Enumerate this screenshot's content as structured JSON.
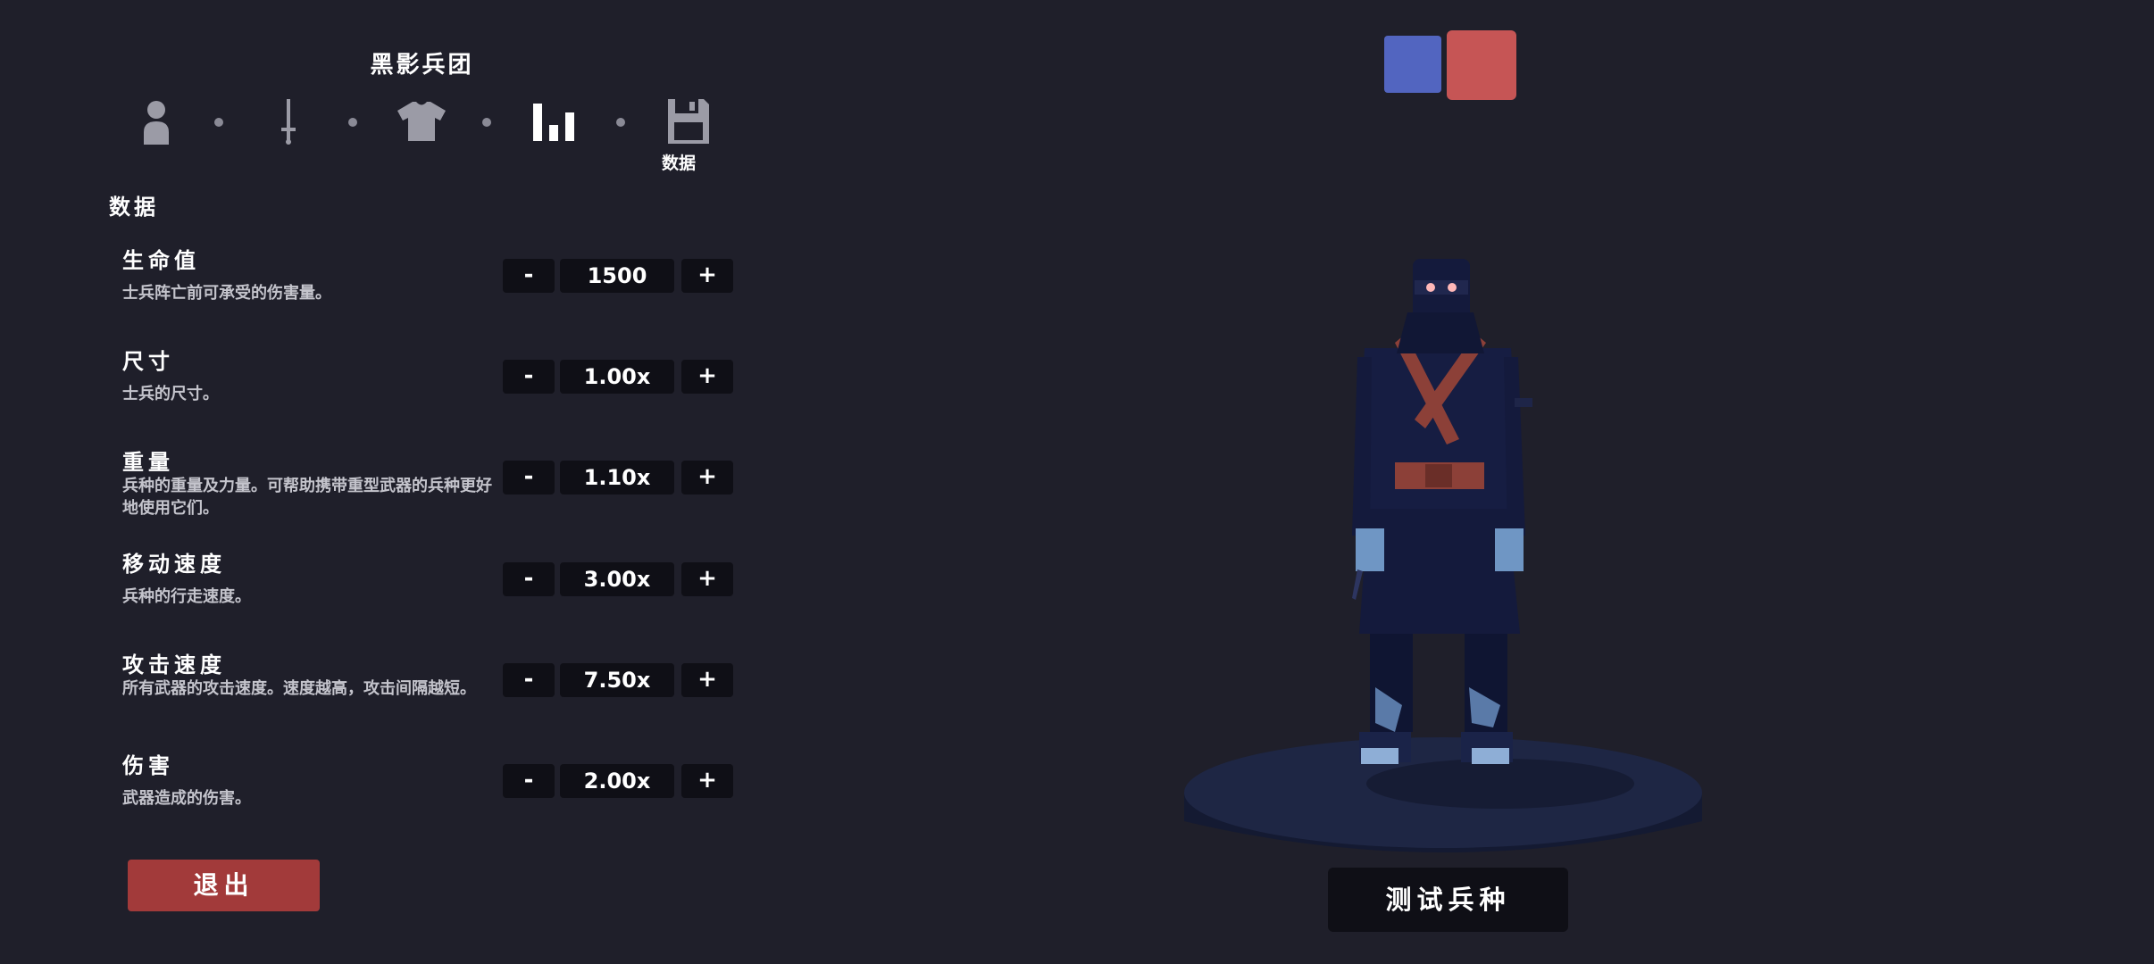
{
  "header": {
    "unit_name": "黑影兵团",
    "steps": [
      {
        "icon": "person-icon"
      },
      {
        "icon": "sword-icon"
      },
      {
        "icon": "shirt-icon"
      },
      {
        "icon": "stats-icon",
        "label": "数据",
        "active": true
      },
      {
        "icon": "save-icon"
      }
    ]
  },
  "section_title": "数据",
  "stats": [
    {
      "name": "生命值",
      "desc": "士兵阵亡前可承受的伤害量。",
      "value": "1500"
    },
    {
      "name": "尺寸",
      "desc": "士兵的尺寸。",
      "value": "1.00x"
    },
    {
      "name": "重量",
      "desc": "兵种的重量及力量。可帮助携带重型武器的兵种更好地使用它们。",
      "value": "1.10x"
    },
    {
      "name": "移动速度",
      "desc": "兵种的行走速度。",
      "value": "3.00x"
    },
    {
      "name": "攻击速度",
      "desc": "所有武器的攻击速度。速度越高，攻击间隔越短。",
      "value": "7.50x"
    },
    {
      "name": "伤害",
      "desc": "武器造成的伤害。",
      "value": "2.00x"
    }
  ],
  "stepper": {
    "minus": "-",
    "plus": "+"
  },
  "buttons": {
    "exit": "退出",
    "test": "测试兵种"
  },
  "colors": {
    "team_blue": "#5265c0",
    "team_red": "#c65555",
    "exit": "#a23a3a",
    "background": "#1f1f2a"
  }
}
